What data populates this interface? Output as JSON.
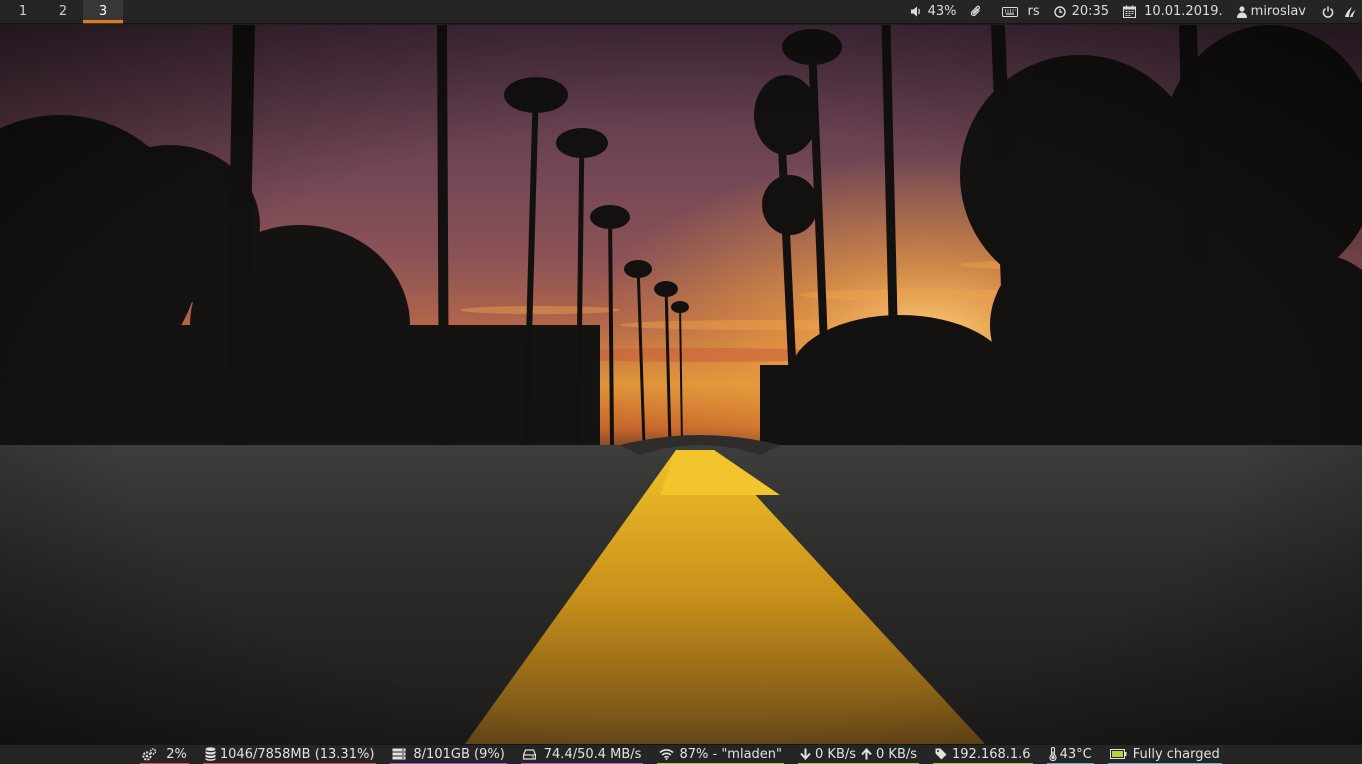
{
  "topbar": {
    "workspaces": [
      "1",
      "2",
      "3"
    ],
    "active_workspace": "3",
    "volume": "43%",
    "keyboard_layout": "rs",
    "time": "20:35",
    "date": "10.01.2019.",
    "user": "miroslav"
  },
  "bottombar": {
    "cpu": "2%",
    "memory": "1046/7858MB (13.31%)",
    "disk": "8/101GB (9%)",
    "disk_io": "74.4/50.4 MB/s",
    "wifi": "87% - \"mladen\"",
    "net_down": "0 KB/s",
    "net_up": "0 KB/s",
    "ip": "192.168.1.6",
    "temperature": "43°C",
    "battery": "Fully charged"
  },
  "colors": {
    "accent": "#e07a1f",
    "bar_bg": "#252525",
    "underline_cpu": "#d9534f",
    "underline_memory": "#d9534f",
    "underline_disk": "#a05fd0",
    "underline_io": "#c05fc0",
    "underline_wifi": "#9acd32",
    "underline_net": "#9acd32",
    "underline_ip": "#9acd32",
    "underline_temp": "#5fb0d0",
    "underline_battery": "#5fb0d0"
  },
  "icons": {
    "volume": "speaker-icon",
    "attachment": "paperclip-icon",
    "keyboard": "keyboard-icon",
    "clock": "clock-icon",
    "calendar": "calendar-icon",
    "user": "user-icon",
    "power": "power-icon",
    "flame": "flame-icon",
    "cpu": "cogs-icon",
    "memory": "database-icon",
    "disk": "hdd-stack-icon",
    "io": "hard-drive-icon",
    "wifi": "wifi-icon",
    "down": "arrow-down-icon",
    "up": "arrow-up-icon",
    "ip": "tag-icon",
    "temp": "thermometer-icon",
    "battery": "battery-icon"
  }
}
